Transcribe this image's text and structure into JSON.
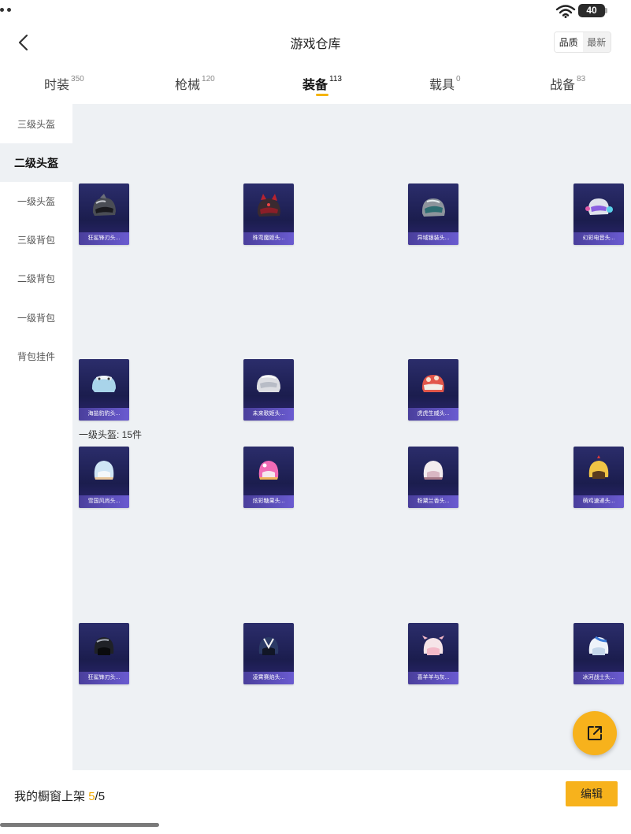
{
  "status": {
    "battery": "40"
  },
  "header": {
    "title": "游戏仓库",
    "sort_options": [
      "品质",
      "最新"
    ]
  },
  "tabs": [
    {
      "label": "时装",
      "count": "350"
    },
    {
      "label": "枪械",
      "count": "120"
    },
    {
      "label": "装备",
      "count": "113"
    },
    {
      "label": "载具",
      "count": "0"
    },
    {
      "label": "战备",
      "count": "83"
    }
  ],
  "sidebar": {
    "items": [
      "三级头盔",
      "二级头盔",
      "一级头盔",
      "三级背包",
      "二级背包",
      "一级背包",
      "背包挂件"
    ],
    "active": "二级头盔"
  },
  "groups": [
    {
      "label": "",
      "items": [
        "狂鲨锋刃头...",
        "殊弯魔姬头...",
        "异域银装头...",
        "幻彩电音头..."
      ]
    },
    {
      "label": "",
      "items": [
        "海盐豹豹头...",
        "未来歌姬头...",
        "虎虎生威头..."
      ]
    },
    {
      "label": "一级头盔: 15件",
      "items": [
        "雪国风尚头...",
        "炫彩糖果头...",
        "粉黛兰香头...",
        "萌鸡速递头..."
      ]
    },
    {
      "label": "",
      "items": [
        "狂鲨锋刃头...",
        "凌霄赛焰头...",
        "喜羊羊与灰...",
        "冰河战士头..."
      ]
    }
  ],
  "footer": {
    "showcase_label": "我的橱窗上架",
    "showcase_current": "5",
    "showcase_total": "/5",
    "edit_label": "编辑"
  },
  "colors": {
    "accent": "#f7b21c",
    "card_bg": "#1b1d4e",
    "card_label": "#5a4db8",
    "content_bg": "#eef1f4"
  }
}
